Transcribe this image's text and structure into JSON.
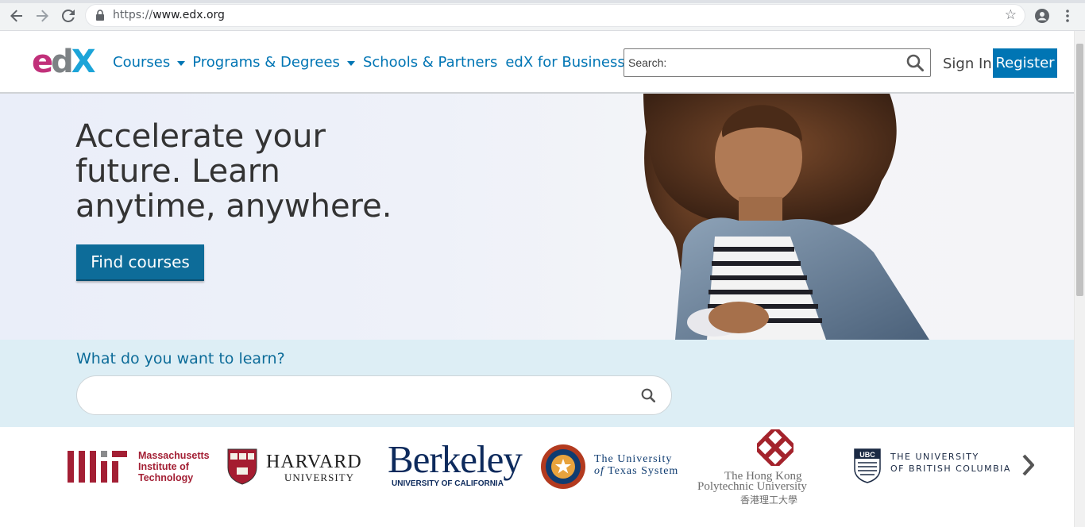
{
  "browser": {
    "url_scheme": "https://",
    "url_host": "www.edx.org"
  },
  "header": {
    "logo_e": "e",
    "logo_d": "d",
    "logo_x": "X",
    "nav": [
      {
        "label": "Courses",
        "has_dropdown": true
      },
      {
        "label": "Programs & Degrees",
        "has_dropdown": true
      },
      {
        "label": "Schools & Partners",
        "has_dropdown": false
      },
      {
        "label": "edX for Business",
        "has_dropdown": false
      }
    ],
    "search_placeholder": "Search:",
    "sign_in": "Sign In",
    "register": "Register"
  },
  "hero": {
    "title": "Accelerate your future. Learn anytime, anywhere.",
    "cta": "Find courses"
  },
  "band": {
    "label": "What do you want to learn?"
  },
  "partners": {
    "mit": {
      "line1": "Massachusetts",
      "line2": "Institute of",
      "line3": "Technology"
    },
    "harvard": {
      "shield_top": "VE RI TAS",
      "name": "HARVARD",
      "sub": "UNIVERSITY"
    },
    "berkeley": {
      "name": "Berkeley",
      "sub": "UNIVERSITY OF CALIFORNIA"
    },
    "texas": {
      "line1": "The University",
      "line2_italic": "of",
      "line2": "Texas System"
    },
    "hk": {
      "line1": "The Hong Kong",
      "line2": "Polytechnic University",
      "line3": "香港理工大學"
    },
    "ubc": {
      "badge": "UBC",
      "line1": "THE UNIVERSITY",
      "line2": "OF BRITISH COLUMBIA"
    }
  },
  "colors": {
    "accent": "#0075b4",
    "cta": "#0d6c99",
    "band": "#ddeef5",
    "mit_red": "#a31f34",
    "berkeley_navy": "#0d2a5c"
  }
}
